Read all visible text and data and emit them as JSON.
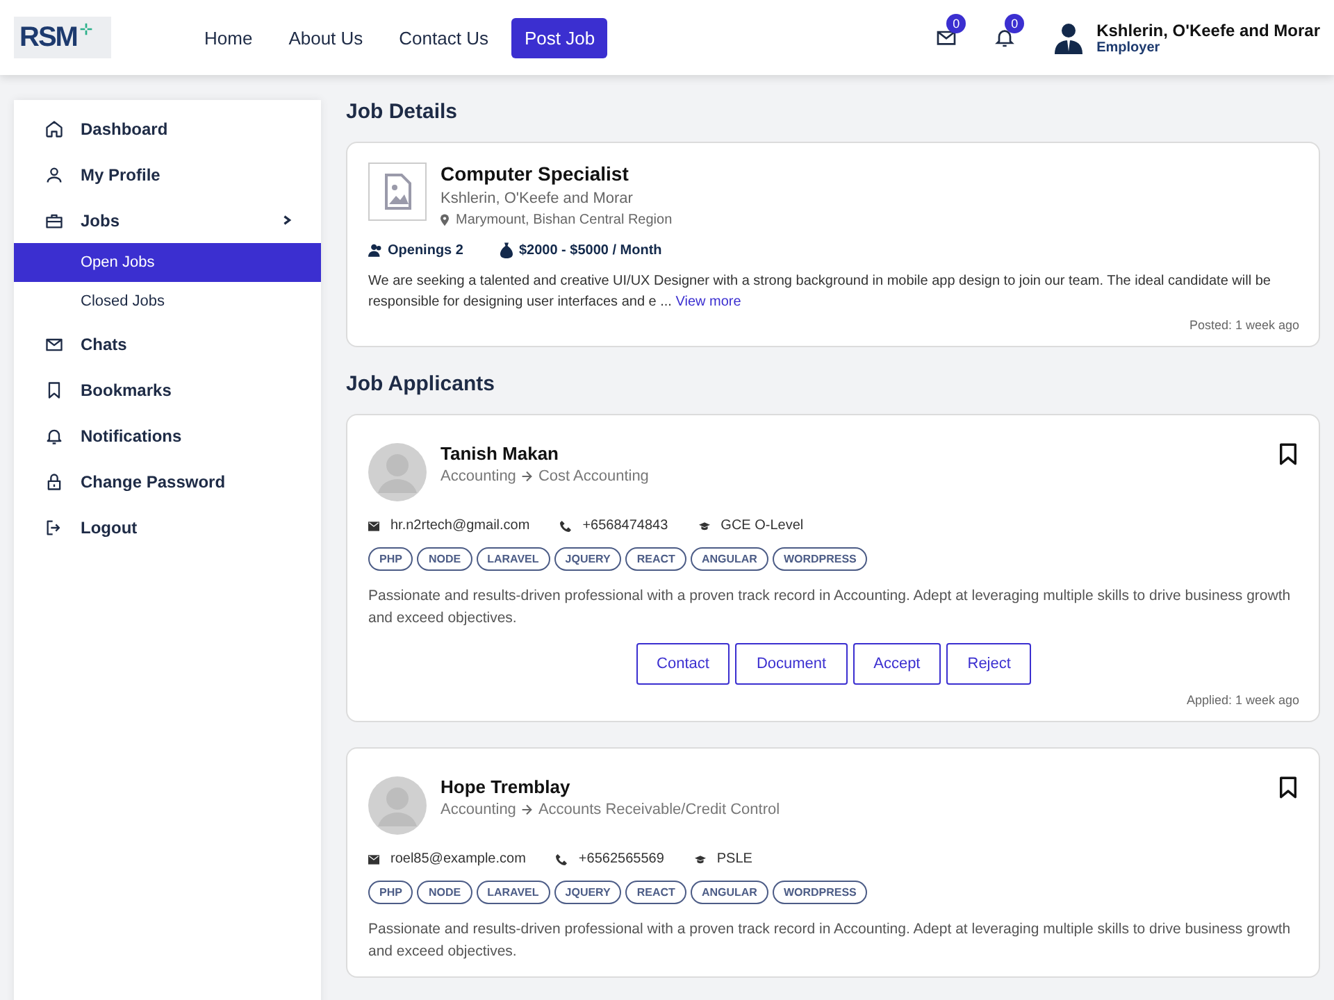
{
  "header": {
    "logo": "RSM",
    "nav": [
      {
        "label": "Home",
        "selected": false
      },
      {
        "label": "About Us",
        "selected": false
      },
      {
        "label": "Contact Us",
        "selected": false
      },
      {
        "label": "Post Job",
        "selected": true
      }
    ],
    "messages_badge": "0",
    "notifications_badge": "0",
    "user": {
      "name": "Kshlerin, O'Keefe and Morar",
      "role": "Employer"
    }
  },
  "sidebar": {
    "items": [
      {
        "label": "Dashboard"
      },
      {
        "label": "My Profile"
      },
      {
        "label": "Jobs",
        "expanded": true,
        "children": [
          {
            "label": "Open Jobs",
            "selected": true
          },
          {
            "label": "Closed Jobs",
            "selected": false
          }
        ]
      },
      {
        "label": "Chats"
      },
      {
        "label": "Bookmarks"
      },
      {
        "label": "Notifications"
      },
      {
        "label": "Change Password"
      },
      {
        "label": "Logout"
      }
    ]
  },
  "job_details": {
    "heading": "Job Details",
    "title": "Computer Specialist",
    "company": "Kshlerin, O'Keefe and Morar",
    "location": "Marymount, Bishan Central Region",
    "openings": "Openings 2",
    "salary": "$2000 - $5000 / Month",
    "description": "We are seeking a talented and creative UI/UX Designer with a strong background in mobile app design to join our team. The ideal candidate will be responsible for designing user interfaces and e ...",
    "view_more": "View more",
    "posted": "Posted: 1 week ago"
  },
  "applicants": {
    "heading": "Job Applicants",
    "items": [
      {
        "name": "Tanish Makan",
        "category": "Accounting",
        "subcategory": "Cost Accounting",
        "email": "hr.n2rtech@gmail.com",
        "phone": "+6568474843",
        "education": "GCE O-Level",
        "skills": [
          "PHP",
          "NODE",
          "LARAVEL",
          "JQUERY",
          "REACT",
          "ANGULAR",
          "WORDPRESS"
        ],
        "summary": "Passionate and results-driven professional with a proven track record in Accounting. Adept at leveraging multiple skills to drive business growth and exceed objectives.",
        "buttons": [
          "Contact",
          "Document",
          "Accept",
          "Reject"
        ],
        "applied": "Applied: 1 week ago"
      },
      {
        "name": "Hope Tremblay",
        "category": "Accounting",
        "subcategory": "Accounts Receivable/Credit Control",
        "email": "roel85@example.com",
        "phone": "+6562565569",
        "education": "PSLE",
        "skills": [
          "PHP",
          "NODE",
          "LARAVEL",
          "JQUERY",
          "REACT",
          "ANGULAR",
          "WORDPRESS"
        ],
        "summary": "Passionate and results-driven professional with a proven track record in Accounting. Adept at leveraging multiple skills to drive business growth and exceed objectives."
      }
    ]
  }
}
